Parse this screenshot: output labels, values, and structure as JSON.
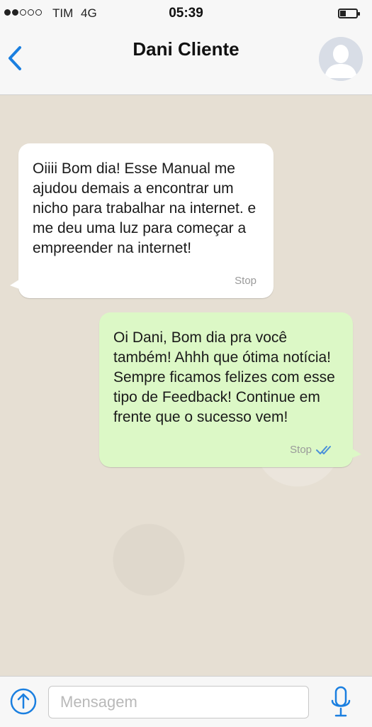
{
  "status_bar": {
    "carrier": "TIM",
    "network": "4G",
    "time": "05:39",
    "battery_level": 0.35
  },
  "header": {
    "contact_name": "Dani Cliente"
  },
  "messages": [
    {
      "direction": "incoming",
      "text": "Oiiii Bom dia! Esse Manual me ajudou demais a encontrar um nicho para trabalhar na internet. e me deu uma luz para começar a empreender na internet!",
      "time": "Stop"
    },
    {
      "direction": "outgoing",
      "text": "Oi Dani, Bom dia pra você também! Ahhh que ótima notícia! Sempre ficamos felizes com esse tipo de Feedback! Continue em frente que o sucesso vem!",
      "time": "Stop"
    }
  ],
  "input": {
    "placeholder": "Mensagem",
    "value": ""
  },
  "colors": {
    "accent": "#1a7fe0",
    "incoming_bubble": "#ffffff",
    "outgoing_bubble": "#dcf8c6",
    "chat_background": "#e6dfd3",
    "read_ticks": "#4a90d9"
  }
}
